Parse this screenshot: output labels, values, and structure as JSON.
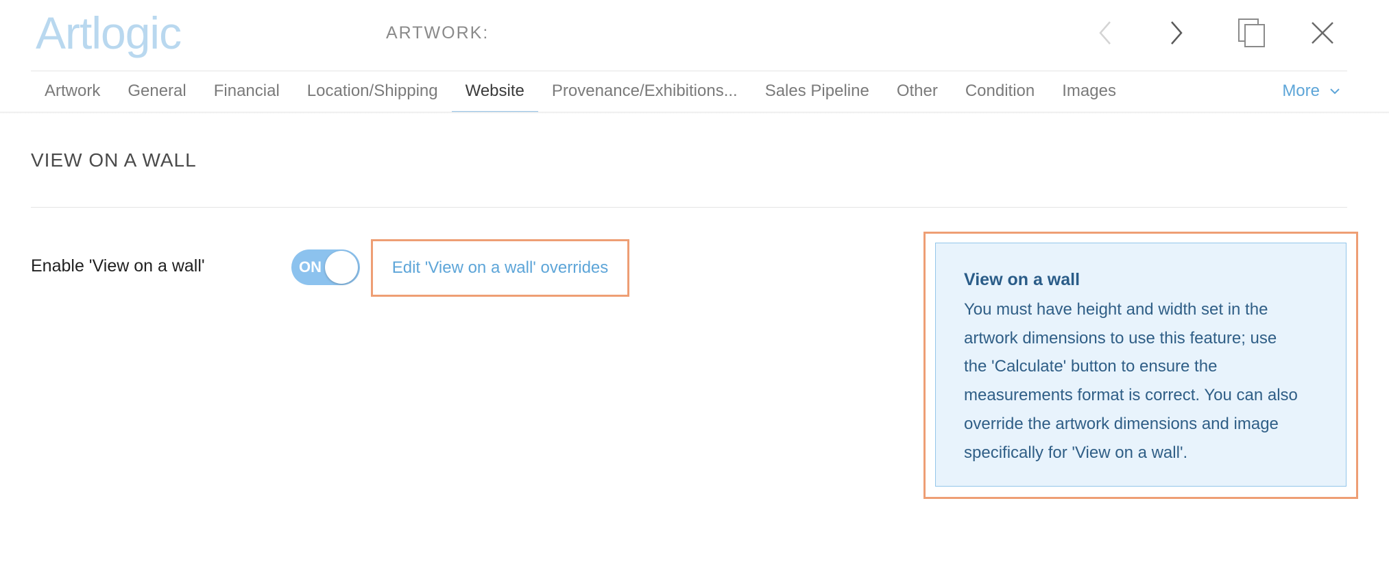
{
  "header": {
    "logo_text": "Artlogic",
    "artwork_label": "ARTWORK:",
    "icons": [
      "chevron-left-icon",
      "chevron-right-icon",
      "copy-icon",
      "close-icon"
    ]
  },
  "tabs": {
    "items": [
      {
        "label": "Artwork",
        "active": false
      },
      {
        "label": "General",
        "active": false
      },
      {
        "label": "Financial",
        "active": false
      },
      {
        "label": "Location/Shipping",
        "active": false
      },
      {
        "label": "Website",
        "active": true
      },
      {
        "label": "Provenance/Exhibitions...",
        "active": false
      },
      {
        "label": "Sales Pipeline",
        "active": false
      },
      {
        "label": "Other",
        "active": false
      },
      {
        "label": "Condition",
        "active": false
      },
      {
        "label": "Images",
        "active": false
      }
    ],
    "more_label": "More"
  },
  "section": {
    "title": "VIEW ON A WALL",
    "enable_label": "Enable 'View on a wall'",
    "toggle_state": "ON",
    "override_link": "Edit 'View on a wall' overrides"
  },
  "info": {
    "title": "View on a wall",
    "lines": [
      "You must have height and width set in the",
      "artwork dimensions to use this feature; use",
      "the 'Calculate' button to ensure the",
      "measurements format is correct. You can also",
      "override the artwork dimensions and image",
      "specifically for 'View on a wall'."
    ]
  },
  "colors": {
    "accent": "#5da5d8",
    "logo": "#b9d8ef",
    "highlight_border": "#ee9e74",
    "info_background": "#e8f3fc",
    "toggle_on": "#8cc2ee"
  }
}
